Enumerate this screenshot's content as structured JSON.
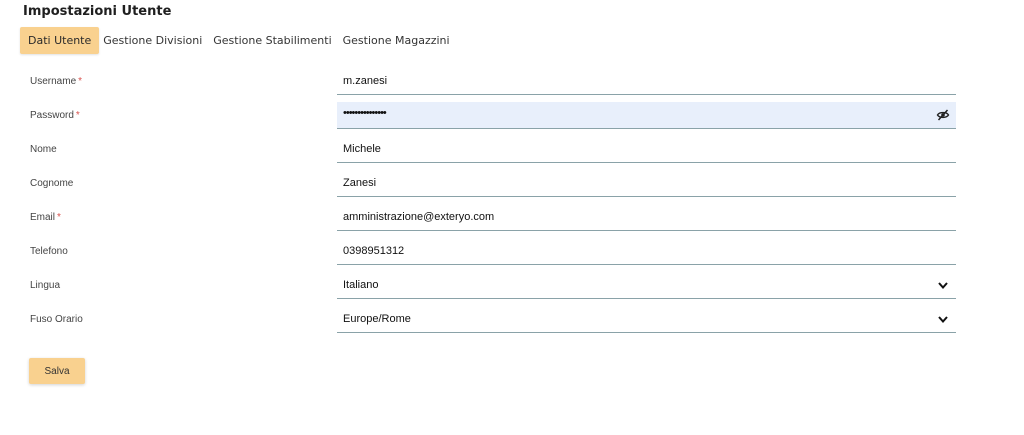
{
  "page": {
    "title": "Impostazioni Utente"
  },
  "tabs": [
    {
      "label": "Dati Utente",
      "active": true
    },
    {
      "label": "Gestione Divisioni",
      "active": false
    },
    {
      "label": "Gestione Stabilimenti",
      "active": false
    },
    {
      "label": "Gestione Magazzini",
      "active": false
    }
  ],
  "form": {
    "username": {
      "label": "Username",
      "required": "*",
      "value": "m.zanesi"
    },
    "password": {
      "label": "Password",
      "required": "*",
      "value": "•••••••••••••••",
      "icon": "eye-slash-icon"
    },
    "nome": {
      "label": "Nome",
      "value": "Michele"
    },
    "cognome": {
      "label": "Cognome",
      "value": "Zanesi"
    },
    "email": {
      "label": "Email",
      "required": "*",
      "value": "amministrazione@exteryo.com"
    },
    "telefono": {
      "label": "Telefono",
      "value": "0398951312"
    },
    "lingua": {
      "label": "Lingua",
      "value": "Italiano",
      "icon": "chevron-down-icon"
    },
    "fuso_orario": {
      "label": "Fuso Orario",
      "value": "Europe/Rome",
      "icon": "chevron-down-icon"
    }
  },
  "actions": {
    "save_label": "Salva"
  },
  "colors": {
    "accent": "#f9d18f",
    "required": "#d9534f",
    "field_underline": "#8aa2a8",
    "password_highlight": "#e8effb"
  }
}
